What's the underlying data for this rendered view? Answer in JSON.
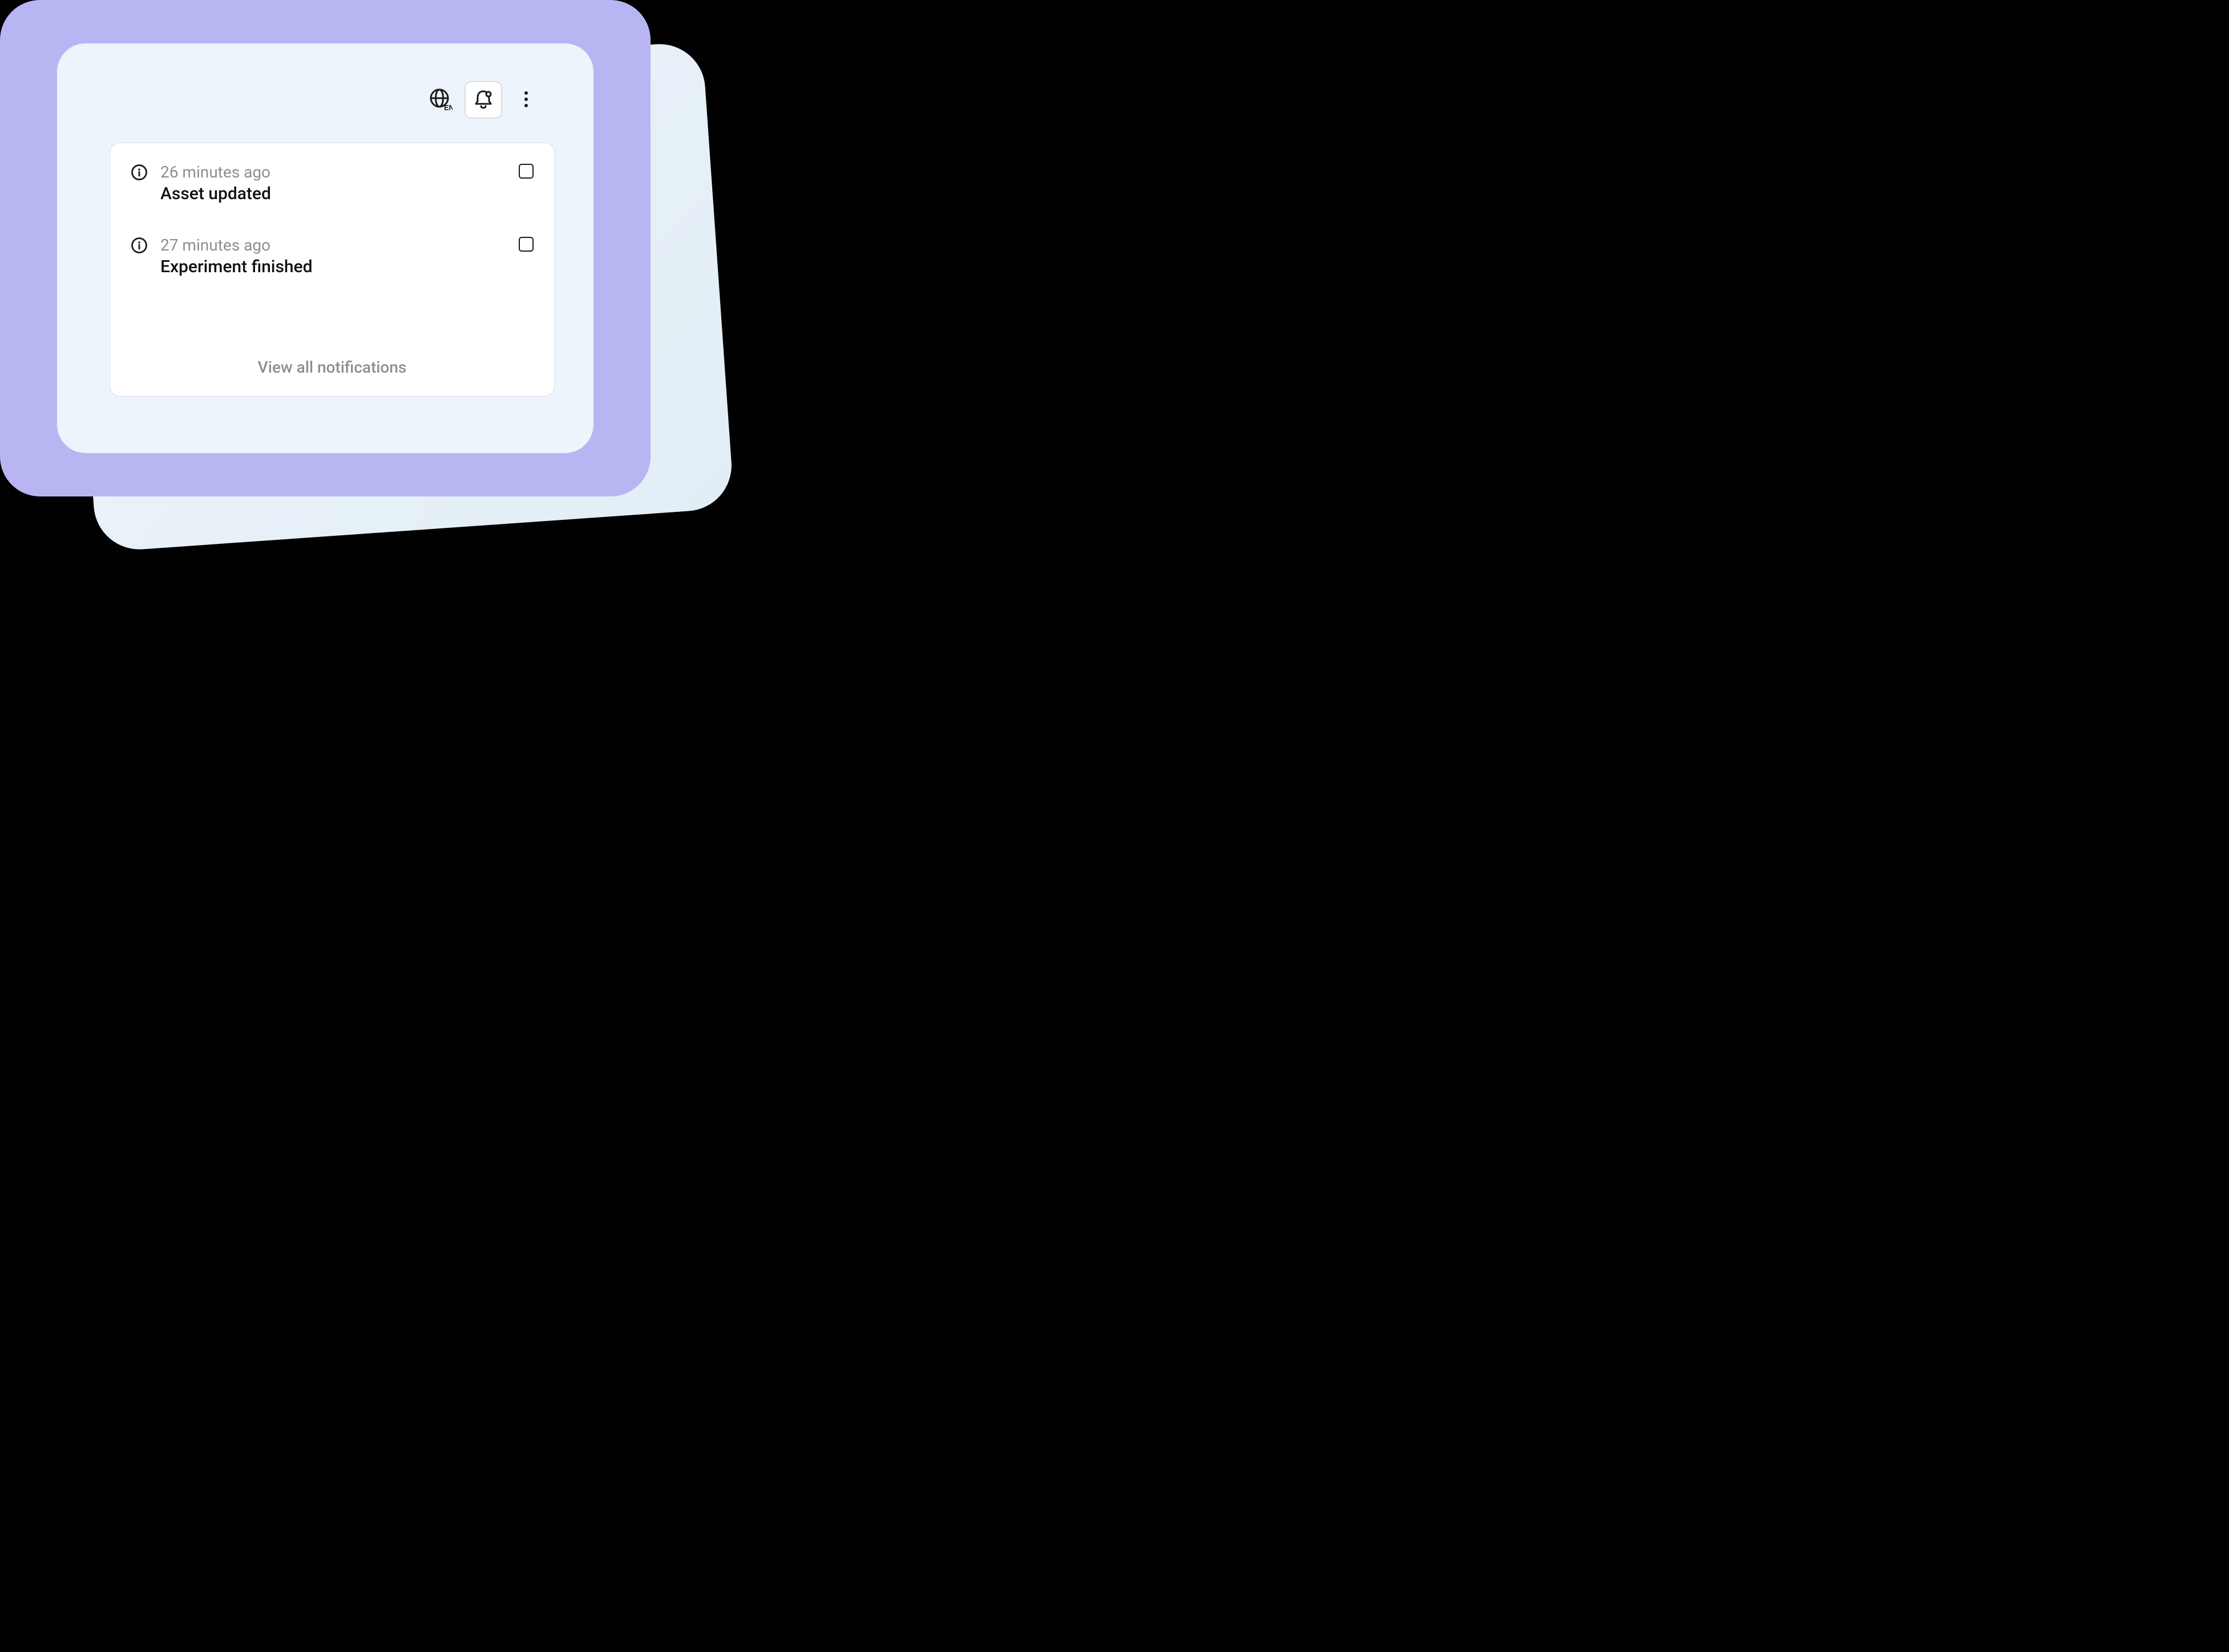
{
  "toolbar": {
    "language_code": "EN"
  },
  "notifications": {
    "items": [
      {
        "time": "26 minutes ago",
        "title": "Asset updated"
      },
      {
        "time": "27 minutes ago",
        "title": "Experiment finished"
      }
    ],
    "view_all_label": "View all notifications"
  }
}
